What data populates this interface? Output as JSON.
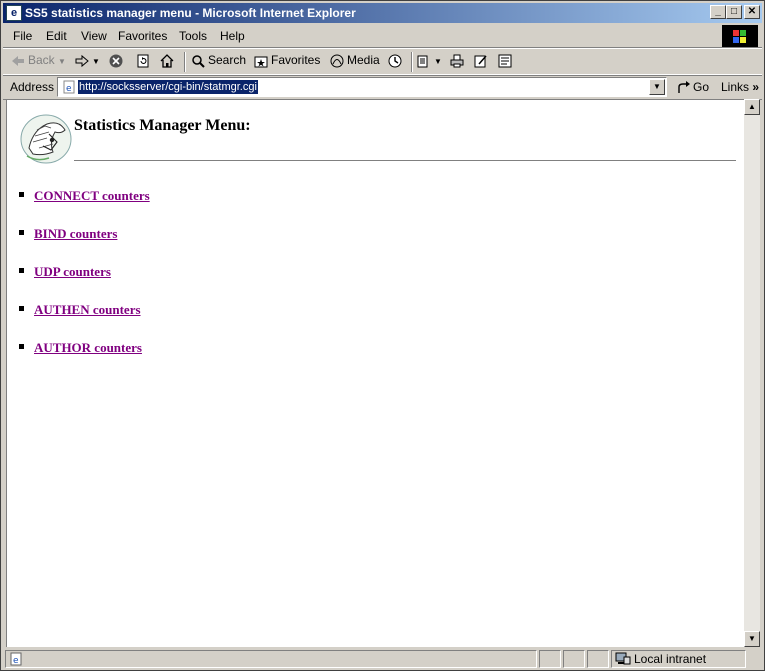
{
  "window": {
    "title": "SS5 statistics manager menu - Microsoft Internet Explorer",
    "minimize_glyph": "_",
    "maximize_glyph": "□",
    "close_glyph": "✕"
  },
  "menubar": {
    "items": [
      {
        "label": "File"
      },
      {
        "label": "Edit"
      },
      {
        "label": "View"
      },
      {
        "label": "Favorites"
      },
      {
        "label": "Tools"
      },
      {
        "label": "Help"
      }
    ]
  },
  "toolbar": {
    "back_label": "Back",
    "search_label": "Search",
    "favorites_label": "Favorites",
    "media_label": "Media"
  },
  "address": {
    "label": "Address",
    "url": "http://socksserver/cgi-bin/statmgr.cgi",
    "go_label": "Go",
    "links_label": "Links"
  },
  "page": {
    "title": "Statistics Manager Menu:",
    "links": [
      {
        "label": "CONNECT counters"
      },
      {
        "label": "BIND counters"
      },
      {
        "label": "UDP counters"
      },
      {
        "label": "AUTHEN counters"
      },
      {
        "label": "AUTHOR counters"
      }
    ]
  },
  "statusbar": {
    "zone_label": "Local intranet"
  },
  "colors": {
    "visited_link": "#800080",
    "title_gradient_start": "#0a246a",
    "chrome": "#d4d0c8"
  },
  "icons": [
    "ie-page-icon",
    "back-arrow-icon",
    "forward-arrow-icon",
    "stop-icon",
    "refresh-icon",
    "home-icon",
    "search-icon",
    "favorites-icon",
    "media-icon",
    "history-icon",
    "mail-icon",
    "print-icon",
    "edit-icon",
    "discuss-icon",
    "go-arrow-icon",
    "windows-logo-icon",
    "ss5-logo-icon"
  ]
}
